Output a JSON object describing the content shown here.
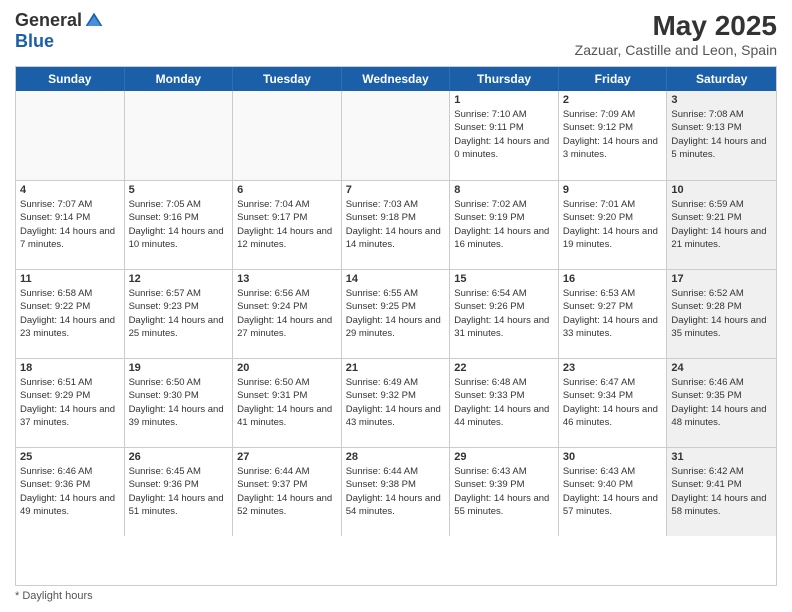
{
  "logo": {
    "general": "General",
    "blue": "Blue"
  },
  "title": {
    "month": "May 2025",
    "location": "Zazuar, Castille and Leon, Spain"
  },
  "header_days": [
    "Sunday",
    "Monday",
    "Tuesday",
    "Wednesday",
    "Thursday",
    "Friday",
    "Saturday"
  ],
  "footer": {
    "label": "Daylight hours"
  },
  "weeks": [
    [
      {
        "day": "",
        "sunrise": "",
        "sunset": "",
        "daylight": "",
        "empty": true
      },
      {
        "day": "",
        "sunrise": "",
        "sunset": "",
        "daylight": "",
        "empty": true
      },
      {
        "day": "",
        "sunrise": "",
        "sunset": "",
        "daylight": "",
        "empty": true
      },
      {
        "day": "",
        "sunrise": "",
        "sunset": "",
        "daylight": "",
        "empty": true
      },
      {
        "day": "1",
        "sunrise": "Sunrise: 7:10 AM",
        "sunset": "Sunset: 9:11 PM",
        "daylight": "Daylight: 14 hours and 0 minutes."
      },
      {
        "day": "2",
        "sunrise": "Sunrise: 7:09 AM",
        "sunset": "Sunset: 9:12 PM",
        "daylight": "Daylight: 14 hours and 3 minutes."
      },
      {
        "day": "3",
        "sunrise": "Sunrise: 7:08 AM",
        "sunset": "Sunset: 9:13 PM",
        "daylight": "Daylight: 14 hours and 5 minutes.",
        "shaded": true
      }
    ],
    [
      {
        "day": "4",
        "sunrise": "Sunrise: 7:07 AM",
        "sunset": "Sunset: 9:14 PM",
        "daylight": "Daylight: 14 hours and 7 minutes."
      },
      {
        "day": "5",
        "sunrise": "Sunrise: 7:05 AM",
        "sunset": "Sunset: 9:16 PM",
        "daylight": "Daylight: 14 hours and 10 minutes."
      },
      {
        "day": "6",
        "sunrise": "Sunrise: 7:04 AM",
        "sunset": "Sunset: 9:17 PM",
        "daylight": "Daylight: 14 hours and 12 minutes."
      },
      {
        "day": "7",
        "sunrise": "Sunrise: 7:03 AM",
        "sunset": "Sunset: 9:18 PM",
        "daylight": "Daylight: 14 hours and 14 minutes."
      },
      {
        "day": "8",
        "sunrise": "Sunrise: 7:02 AM",
        "sunset": "Sunset: 9:19 PM",
        "daylight": "Daylight: 14 hours and 16 minutes."
      },
      {
        "day": "9",
        "sunrise": "Sunrise: 7:01 AM",
        "sunset": "Sunset: 9:20 PM",
        "daylight": "Daylight: 14 hours and 19 minutes."
      },
      {
        "day": "10",
        "sunrise": "Sunrise: 6:59 AM",
        "sunset": "Sunset: 9:21 PM",
        "daylight": "Daylight: 14 hours and 21 minutes.",
        "shaded": true
      }
    ],
    [
      {
        "day": "11",
        "sunrise": "Sunrise: 6:58 AM",
        "sunset": "Sunset: 9:22 PM",
        "daylight": "Daylight: 14 hours and 23 minutes."
      },
      {
        "day": "12",
        "sunrise": "Sunrise: 6:57 AM",
        "sunset": "Sunset: 9:23 PM",
        "daylight": "Daylight: 14 hours and 25 minutes."
      },
      {
        "day": "13",
        "sunrise": "Sunrise: 6:56 AM",
        "sunset": "Sunset: 9:24 PM",
        "daylight": "Daylight: 14 hours and 27 minutes."
      },
      {
        "day": "14",
        "sunrise": "Sunrise: 6:55 AM",
        "sunset": "Sunset: 9:25 PM",
        "daylight": "Daylight: 14 hours and 29 minutes."
      },
      {
        "day": "15",
        "sunrise": "Sunrise: 6:54 AM",
        "sunset": "Sunset: 9:26 PM",
        "daylight": "Daylight: 14 hours and 31 minutes."
      },
      {
        "day": "16",
        "sunrise": "Sunrise: 6:53 AM",
        "sunset": "Sunset: 9:27 PM",
        "daylight": "Daylight: 14 hours and 33 minutes."
      },
      {
        "day": "17",
        "sunrise": "Sunrise: 6:52 AM",
        "sunset": "Sunset: 9:28 PM",
        "daylight": "Daylight: 14 hours and 35 minutes.",
        "shaded": true
      }
    ],
    [
      {
        "day": "18",
        "sunrise": "Sunrise: 6:51 AM",
        "sunset": "Sunset: 9:29 PM",
        "daylight": "Daylight: 14 hours and 37 minutes."
      },
      {
        "day": "19",
        "sunrise": "Sunrise: 6:50 AM",
        "sunset": "Sunset: 9:30 PM",
        "daylight": "Daylight: 14 hours and 39 minutes."
      },
      {
        "day": "20",
        "sunrise": "Sunrise: 6:50 AM",
        "sunset": "Sunset: 9:31 PM",
        "daylight": "Daylight: 14 hours and 41 minutes."
      },
      {
        "day": "21",
        "sunrise": "Sunrise: 6:49 AM",
        "sunset": "Sunset: 9:32 PM",
        "daylight": "Daylight: 14 hours and 43 minutes."
      },
      {
        "day": "22",
        "sunrise": "Sunrise: 6:48 AM",
        "sunset": "Sunset: 9:33 PM",
        "daylight": "Daylight: 14 hours and 44 minutes."
      },
      {
        "day": "23",
        "sunrise": "Sunrise: 6:47 AM",
        "sunset": "Sunset: 9:34 PM",
        "daylight": "Daylight: 14 hours and 46 minutes."
      },
      {
        "day": "24",
        "sunrise": "Sunrise: 6:46 AM",
        "sunset": "Sunset: 9:35 PM",
        "daylight": "Daylight: 14 hours and 48 minutes.",
        "shaded": true
      }
    ],
    [
      {
        "day": "25",
        "sunrise": "Sunrise: 6:46 AM",
        "sunset": "Sunset: 9:36 PM",
        "daylight": "Daylight: 14 hours and 49 minutes."
      },
      {
        "day": "26",
        "sunrise": "Sunrise: 6:45 AM",
        "sunset": "Sunset: 9:36 PM",
        "daylight": "Daylight: 14 hours and 51 minutes."
      },
      {
        "day": "27",
        "sunrise": "Sunrise: 6:44 AM",
        "sunset": "Sunset: 9:37 PM",
        "daylight": "Daylight: 14 hours and 52 minutes."
      },
      {
        "day": "28",
        "sunrise": "Sunrise: 6:44 AM",
        "sunset": "Sunset: 9:38 PM",
        "daylight": "Daylight: 14 hours and 54 minutes."
      },
      {
        "day": "29",
        "sunrise": "Sunrise: 6:43 AM",
        "sunset": "Sunset: 9:39 PM",
        "daylight": "Daylight: 14 hours and 55 minutes."
      },
      {
        "day": "30",
        "sunrise": "Sunrise: 6:43 AM",
        "sunset": "Sunset: 9:40 PM",
        "daylight": "Daylight: 14 hours and 57 minutes."
      },
      {
        "day": "31",
        "sunrise": "Sunrise: 6:42 AM",
        "sunset": "Sunset: 9:41 PM",
        "daylight": "Daylight: 14 hours and 58 minutes.",
        "shaded": true
      }
    ]
  ]
}
